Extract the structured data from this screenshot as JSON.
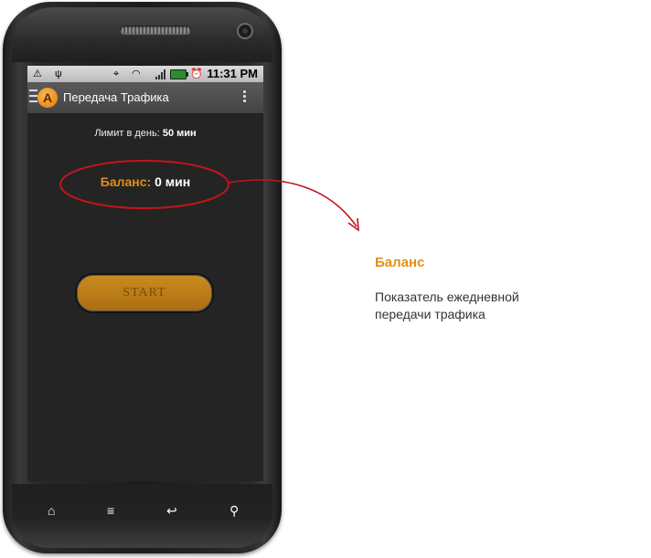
{
  "statusbar": {
    "time": "11:31 PM",
    "left_icons": [
      "warning-icon",
      "usb-icon"
    ],
    "right_icons": [
      "gps-icon",
      "wifi-icon",
      "signal-icon",
      "battery-icon",
      "alarm-icon"
    ]
  },
  "actionbar": {
    "logo_letter": "A",
    "title": "Передача Трафика"
  },
  "main": {
    "limit_label": "Лимит в день:",
    "limit_value": "50 мин",
    "balance_label": "Баланс:",
    "balance_value": "0 мин",
    "start_label": "START"
  },
  "navkeys": [
    {
      "name": "home-key-icon",
      "glyph": "⌂"
    },
    {
      "name": "menu-key-icon",
      "glyph": "≡"
    },
    {
      "name": "back-key-icon",
      "glyph": "↩"
    },
    {
      "name": "search-key-icon",
      "glyph": "⚲"
    }
  ],
  "annotation": {
    "title": "Баланс",
    "text": "Показатель ежедневной передачи трафика",
    "color": "#e08e1d",
    "ring_color": "#c0161b"
  }
}
